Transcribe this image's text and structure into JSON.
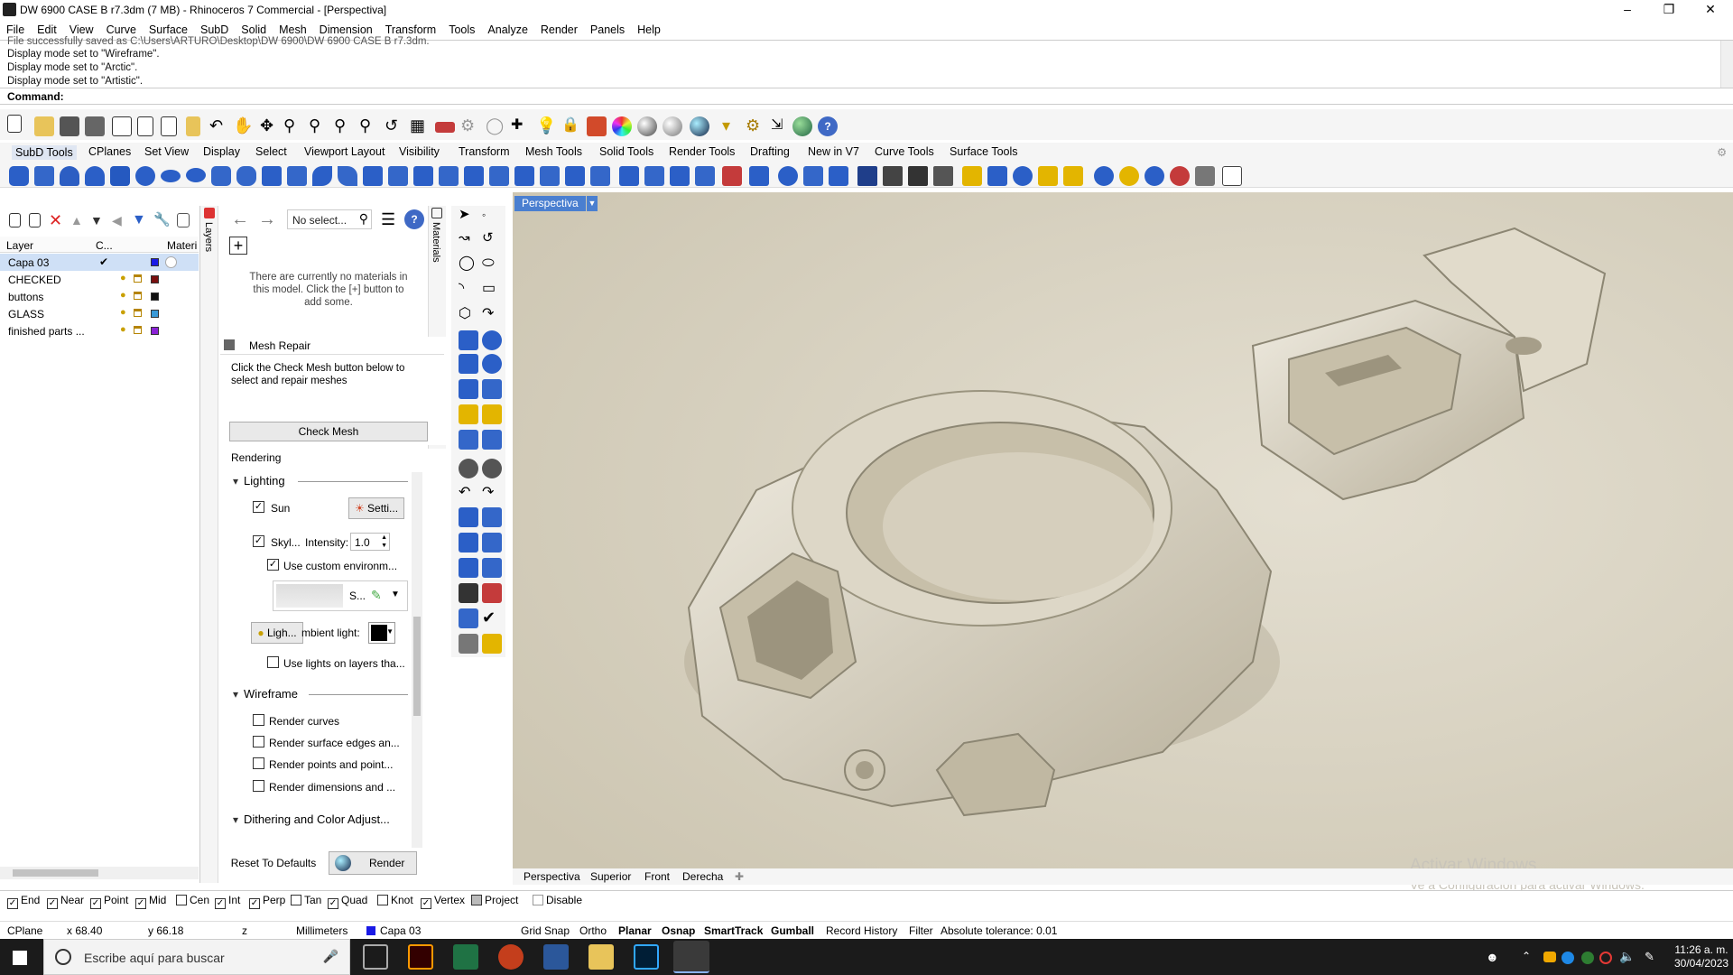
{
  "window": {
    "title": "DW 6900 CASE B r7.3dm (7 MB) - Rhinoceros 7 Commercial - [Perspectiva]"
  },
  "menu": [
    "File",
    "Edit",
    "View",
    "Curve",
    "Surface",
    "SubD",
    "Solid",
    "Mesh",
    "Dimension",
    "Transform",
    "Tools",
    "Analyze",
    "Render",
    "Panels",
    "Help"
  ],
  "command_history": [
    "File successfully saved as C:\\Users\\ARTURO\\Desktop\\DW 6900\\DW 6900 CASE B r7.3dm.",
    "Display mode set to \"Wireframe\".",
    "Display mode set to \"Arctic\".",
    "Display mode set to \"Artistic\"."
  ],
  "command_prompt": "Command:",
  "toolbar_tabs": [
    "SubD Tools",
    "CPlanes",
    "Set View",
    "Display",
    "Select",
    "Viewport Layout",
    "Visibility",
    "Transform",
    "Mesh Tools",
    "Solid Tools",
    "Render Tools",
    "Drafting",
    "New in V7",
    "Curve Tools",
    "Surface Tools"
  ],
  "layers": {
    "col_layer": "Layer",
    "col_current": "C...",
    "col_material": "Materi",
    "tab_label": "Layers",
    "rows": [
      {
        "name": "Capa 03",
        "color": "#1a1ae6",
        "current": true
      },
      {
        "name": "CHECKED",
        "color": "#7a1010"
      },
      {
        "name": "buttons",
        "color": "#111111"
      },
      {
        "name": "GLASS",
        "color": "#3a9ad8"
      },
      {
        "name": "finished parts ...",
        "color": "#8b22d6"
      }
    ]
  },
  "materials": {
    "tab_label": "Materials",
    "search_placeholder": "No select...",
    "empty_message": "There are currently no materials in this model. Click the [+] button to add some."
  },
  "mesh_repair": {
    "title": "Mesh Repair",
    "description": "Click the Check Mesh button below to select and repair meshes",
    "button": "Check Mesh"
  },
  "rendering": {
    "title": "Rendering",
    "lighting": {
      "title": "Lighting",
      "sun_label": "Sun",
      "sun_settings": "Setti...",
      "skylight_label": "Skyl...",
      "intensity_label": "Intensity:",
      "intensity_value": "1.0",
      "custom_env_label": "Use custom environm...",
      "env_button": "S...",
      "lights_button": "Ligh...",
      "ambient_label": "mbient light:",
      "use_lights_layers": "Use lights on layers tha..."
    },
    "wireframe": {
      "title": "Wireframe",
      "options": [
        "Render curves",
        "Render surface edges an...",
        "Render points and point...",
        "Render dimensions and ..."
      ]
    },
    "dithering_title": "Dithering and Color Adjust...",
    "reset_button": "Reset To Defaults",
    "render_button": "Render"
  },
  "viewport": {
    "label": "Perspectiva",
    "tabs": [
      "Perspectiva",
      "Superior",
      "Front",
      "Derecha"
    ]
  },
  "osnaps": [
    {
      "label": "End",
      "checked": true
    },
    {
      "label": "Near",
      "checked": true
    },
    {
      "label": "Point",
      "checked": true
    },
    {
      "label": "Mid",
      "checked": true
    },
    {
      "label": "Cen",
      "checked": false
    },
    {
      "label": "Int",
      "checked": true
    },
    {
      "label": "Perp",
      "checked": true
    },
    {
      "label": "Tan",
      "checked": false
    },
    {
      "label": "Quad",
      "checked": true
    },
    {
      "label": "Knot",
      "checked": false
    },
    {
      "label": "Vertex",
      "checked": true
    },
    {
      "label": "Project",
      "checked": false
    },
    {
      "label": "Disable",
      "checked": false
    }
  ],
  "status": {
    "cplane": "CPlane",
    "x": "x 68.40",
    "y": "y 66.18",
    "z": "z",
    "units": "Millimeters",
    "layer": "Capa 03",
    "grid_snap": "Grid Snap",
    "ortho": "Ortho",
    "planar": "Planar",
    "osnap": "Osnap",
    "smarttrack": "SmartTrack",
    "gumball": "Gumball",
    "record_history": "Record History",
    "filter": "Filter",
    "tolerance": "Absolute tolerance: 0.01"
  },
  "watermark": {
    "line1": "Activar Windows",
    "line2": "Ve a Configuración para activar Windows."
  },
  "taskbar": {
    "search_placeholder": "Escribe aquí para buscar",
    "time": "11:26 a. m.",
    "date": "30/04/2023"
  }
}
